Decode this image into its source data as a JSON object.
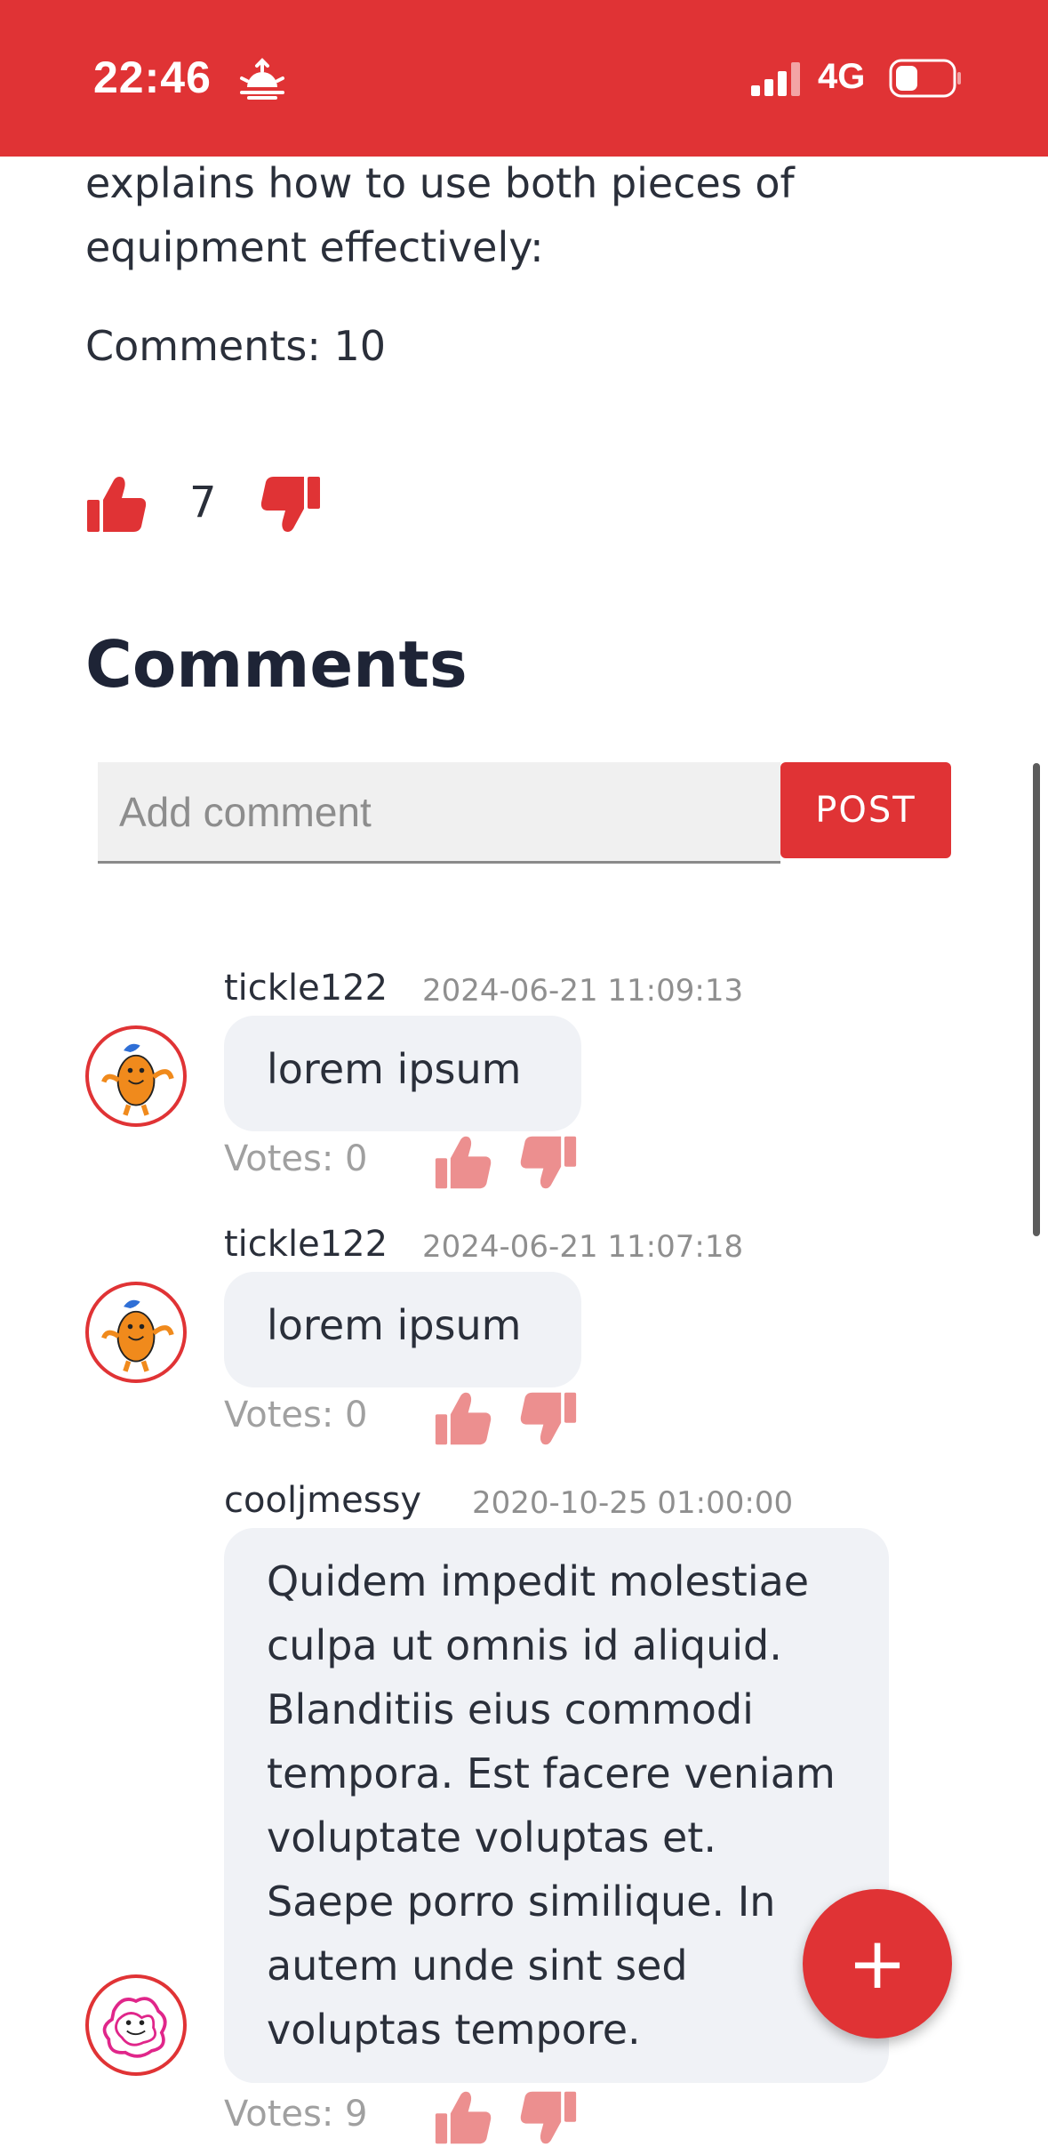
{
  "status_bar": {
    "time": "22:46",
    "network": "4G",
    "icons": [
      "sunrise-icon",
      "signal-icon",
      "battery-icon"
    ],
    "color": "#e03335"
  },
  "article": {
    "text": "explains how to use both pieces of equipment effectively:",
    "comment_count": "Comments: 10",
    "votes": "7"
  },
  "comments_section": {
    "heading": "Comments",
    "input_placeholder": "Add comment",
    "post_label": "POST"
  },
  "comments": [
    {
      "user": "tickle122",
      "date": "2024-06-21 11:09:13",
      "text": "lorem ipsum",
      "votes": "Votes: 0",
      "avatar": "orange-character-avatar"
    },
    {
      "user": "tickle122",
      "date": "2024-06-21 11:07:18",
      "text": "lorem ipsum",
      "votes": "Votes: 0",
      "avatar": "orange-character-avatar"
    },
    {
      "user": "cooljmessy",
      "date": "2020-10-25 01:00:00",
      "text": "Quidem impedit molestiae culpa ut omnis id aliquid. Blanditiis eius commodi tempora. Est facere veniam voluptate voluptas et. Saepe porro similique. In autem unde sint sed voluptas tempore.",
      "votes": "Votes: 9",
      "avatar": "pink-scribble-avatar"
    }
  ],
  "fab": {
    "label": "+"
  },
  "accent_color": "#e03335",
  "faded_accent_color": "#ec8f8f"
}
